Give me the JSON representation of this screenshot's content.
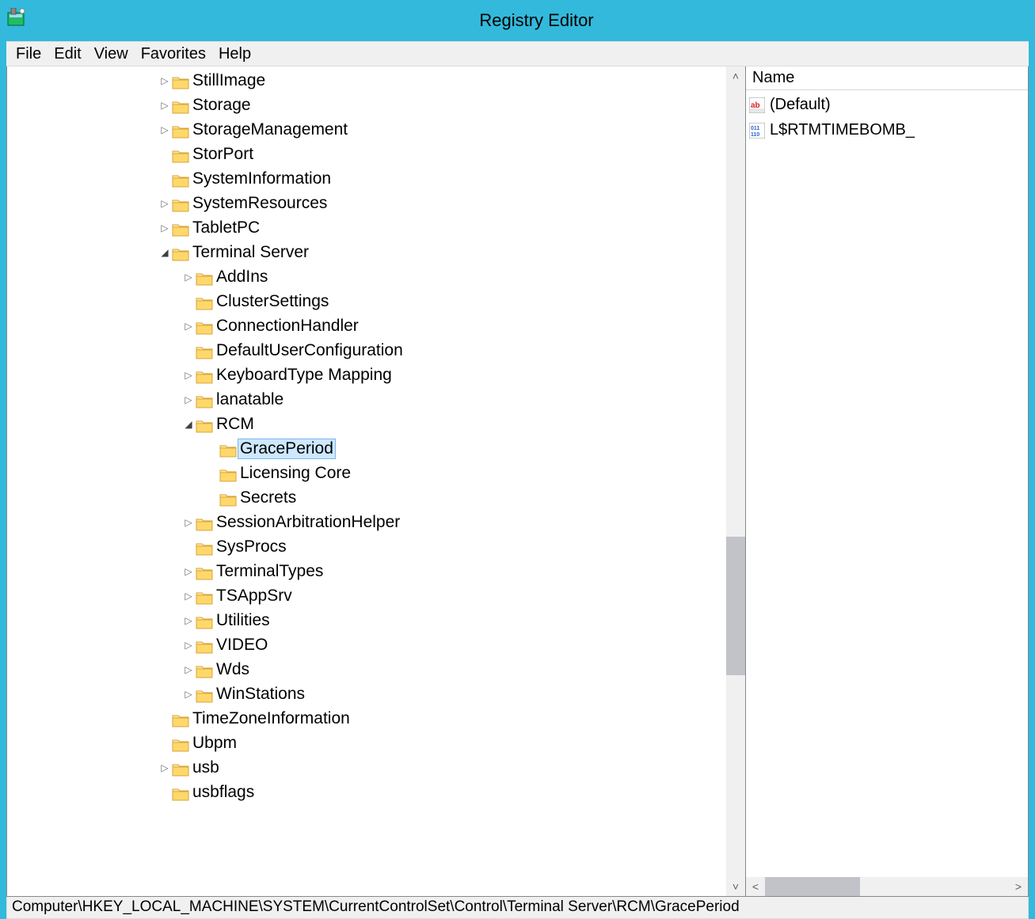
{
  "window": {
    "title": "Registry Editor"
  },
  "menu": {
    "file": "File",
    "edit": "Edit",
    "view": "View",
    "favorites": "Favorites",
    "help": "Help"
  },
  "tree": {
    "items": [
      {
        "depth": 6,
        "exp": "collapsed",
        "label": "StillImage"
      },
      {
        "depth": 6,
        "exp": "collapsed",
        "label": "Storage"
      },
      {
        "depth": 6,
        "exp": "collapsed",
        "label": "StorageManagement"
      },
      {
        "depth": 6,
        "exp": "none",
        "label": "StorPort"
      },
      {
        "depth": 6,
        "exp": "none",
        "label": "SystemInformation"
      },
      {
        "depth": 6,
        "exp": "collapsed",
        "label": "SystemResources"
      },
      {
        "depth": 6,
        "exp": "collapsed",
        "label": "TabletPC"
      },
      {
        "depth": 6,
        "exp": "expanded",
        "label": "Terminal Server"
      },
      {
        "depth": 7,
        "exp": "collapsed",
        "label": "AddIns"
      },
      {
        "depth": 7,
        "exp": "none",
        "label": "ClusterSettings"
      },
      {
        "depth": 7,
        "exp": "collapsed",
        "label": "ConnectionHandler"
      },
      {
        "depth": 7,
        "exp": "none",
        "label": "DefaultUserConfiguration"
      },
      {
        "depth": 7,
        "exp": "collapsed",
        "label": "KeyboardType Mapping"
      },
      {
        "depth": 7,
        "exp": "collapsed",
        "label": "lanatable"
      },
      {
        "depth": 7,
        "exp": "expanded",
        "label": "RCM"
      },
      {
        "depth": 8,
        "exp": "none",
        "label": "GracePeriod",
        "selected": true
      },
      {
        "depth": 8,
        "exp": "none",
        "label": "Licensing Core"
      },
      {
        "depth": 8,
        "exp": "none",
        "label": "Secrets"
      },
      {
        "depth": 7,
        "exp": "collapsed",
        "label": "SessionArbitrationHelper"
      },
      {
        "depth": 7,
        "exp": "none",
        "label": "SysProcs"
      },
      {
        "depth": 7,
        "exp": "collapsed",
        "label": "TerminalTypes"
      },
      {
        "depth": 7,
        "exp": "collapsed",
        "label": "TSAppSrv"
      },
      {
        "depth": 7,
        "exp": "collapsed",
        "label": "Utilities"
      },
      {
        "depth": 7,
        "exp": "collapsed",
        "label": "VIDEO"
      },
      {
        "depth": 7,
        "exp": "collapsed",
        "label": "Wds"
      },
      {
        "depth": 7,
        "exp": "collapsed",
        "label": "WinStations"
      },
      {
        "depth": 6,
        "exp": "none",
        "label": "TimeZoneInformation"
      },
      {
        "depth": 6,
        "exp": "none",
        "label": "Ubpm"
      },
      {
        "depth": 6,
        "exp": "collapsed",
        "label": "usb"
      },
      {
        "depth": 6,
        "exp": "none",
        "label": "usbflags"
      }
    ]
  },
  "list": {
    "header": {
      "name": "Name"
    },
    "rows": [
      {
        "icon": "string",
        "label": "(Default)"
      },
      {
        "icon": "binary",
        "label": "L$RTMTIMEBOMB_"
      }
    ]
  },
  "status": {
    "path": "Computer\\HKEY_LOCAL_MACHINE\\SYSTEM\\CurrentControlSet\\Control\\Terminal Server\\RCM\\GracePeriod"
  }
}
